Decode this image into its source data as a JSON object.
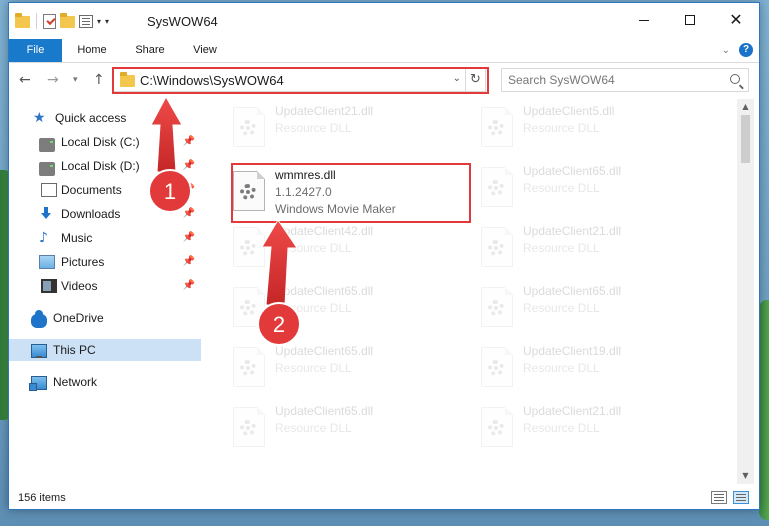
{
  "window": {
    "title": "SysWOW64",
    "minimize_label": "",
    "close_label": "✕"
  },
  "ribbon": {
    "tabs": [
      "File",
      "Home",
      "Share",
      "View"
    ]
  },
  "navigation": {
    "address": "C:\\Windows\\SysWOW64",
    "search_placeholder": "Search SysWOW64"
  },
  "sidebar": {
    "items": [
      {
        "label": "Quick access",
        "icon": "star-icon"
      },
      {
        "label": "Local Disk (C:)",
        "icon": "disk-icon",
        "pinned": true
      },
      {
        "label": "Local Disk (D:)",
        "icon": "disk-icon",
        "pinned": true
      },
      {
        "label": "Documents",
        "icon": "documents-icon",
        "pinned": true
      },
      {
        "label": "Downloads",
        "icon": "downloads-icon",
        "pinned": true
      },
      {
        "label": "Music",
        "icon": "music-icon",
        "pinned": true
      },
      {
        "label": "Pictures",
        "icon": "pictures-icon",
        "pinned": true
      },
      {
        "label": "Videos",
        "icon": "videos-icon",
        "pinned": true
      },
      {
        "label": "OneDrive",
        "icon": "cloud-icon"
      },
      {
        "label": "This PC",
        "icon": "pc-icon",
        "selected": true
      },
      {
        "label": "Network",
        "icon": "network-icon"
      }
    ]
  },
  "files": {
    "left_column": [
      {
        "name": "UpdateClient21.dll",
        "detail": "Resource DLL",
        "faded": true
      },
      {
        "name": "wmmres.dll",
        "version": "1.1.2427.0",
        "detail": "Windows Movie Maker",
        "faded": false
      },
      {
        "name": "UpdateClient42.dll",
        "detail": "Resource DLL",
        "faded": true
      },
      {
        "name": "UpdateClient65.dll",
        "detail": "Resource DLL",
        "faded": true
      },
      {
        "name": "UpdateClient65.dll",
        "detail": "Resource DLL",
        "faded": true
      },
      {
        "name": "UpdateClient65.dll",
        "detail": "Resource DLL",
        "faded": true
      }
    ],
    "right_column": [
      {
        "name": "UpdateClient5.dll",
        "detail": "Resource DLL",
        "faded": true
      },
      {
        "name": "UpdateClient65.dll",
        "detail": "Resource DLL",
        "faded": true
      },
      {
        "name": "UpdateClient21.dll",
        "detail": "Resource DLL",
        "faded": true
      },
      {
        "name": "UpdateClient65.dll",
        "detail": "Resource DLL",
        "faded": true
      },
      {
        "name": "UpdateClient19.dll",
        "detail": "Resource DLL",
        "faded": true
      },
      {
        "name": "UpdateClient21.dll",
        "detail": "Resource DLL",
        "faded": true
      }
    ]
  },
  "status": {
    "item_count": "156 items"
  },
  "annotations": {
    "step1": "1",
    "step2": "2",
    "color": "#e23a3a"
  },
  "colors": {
    "accent": "#1979ca",
    "highlight": "#e23a3a",
    "selected_bg": "#cce1f5"
  }
}
